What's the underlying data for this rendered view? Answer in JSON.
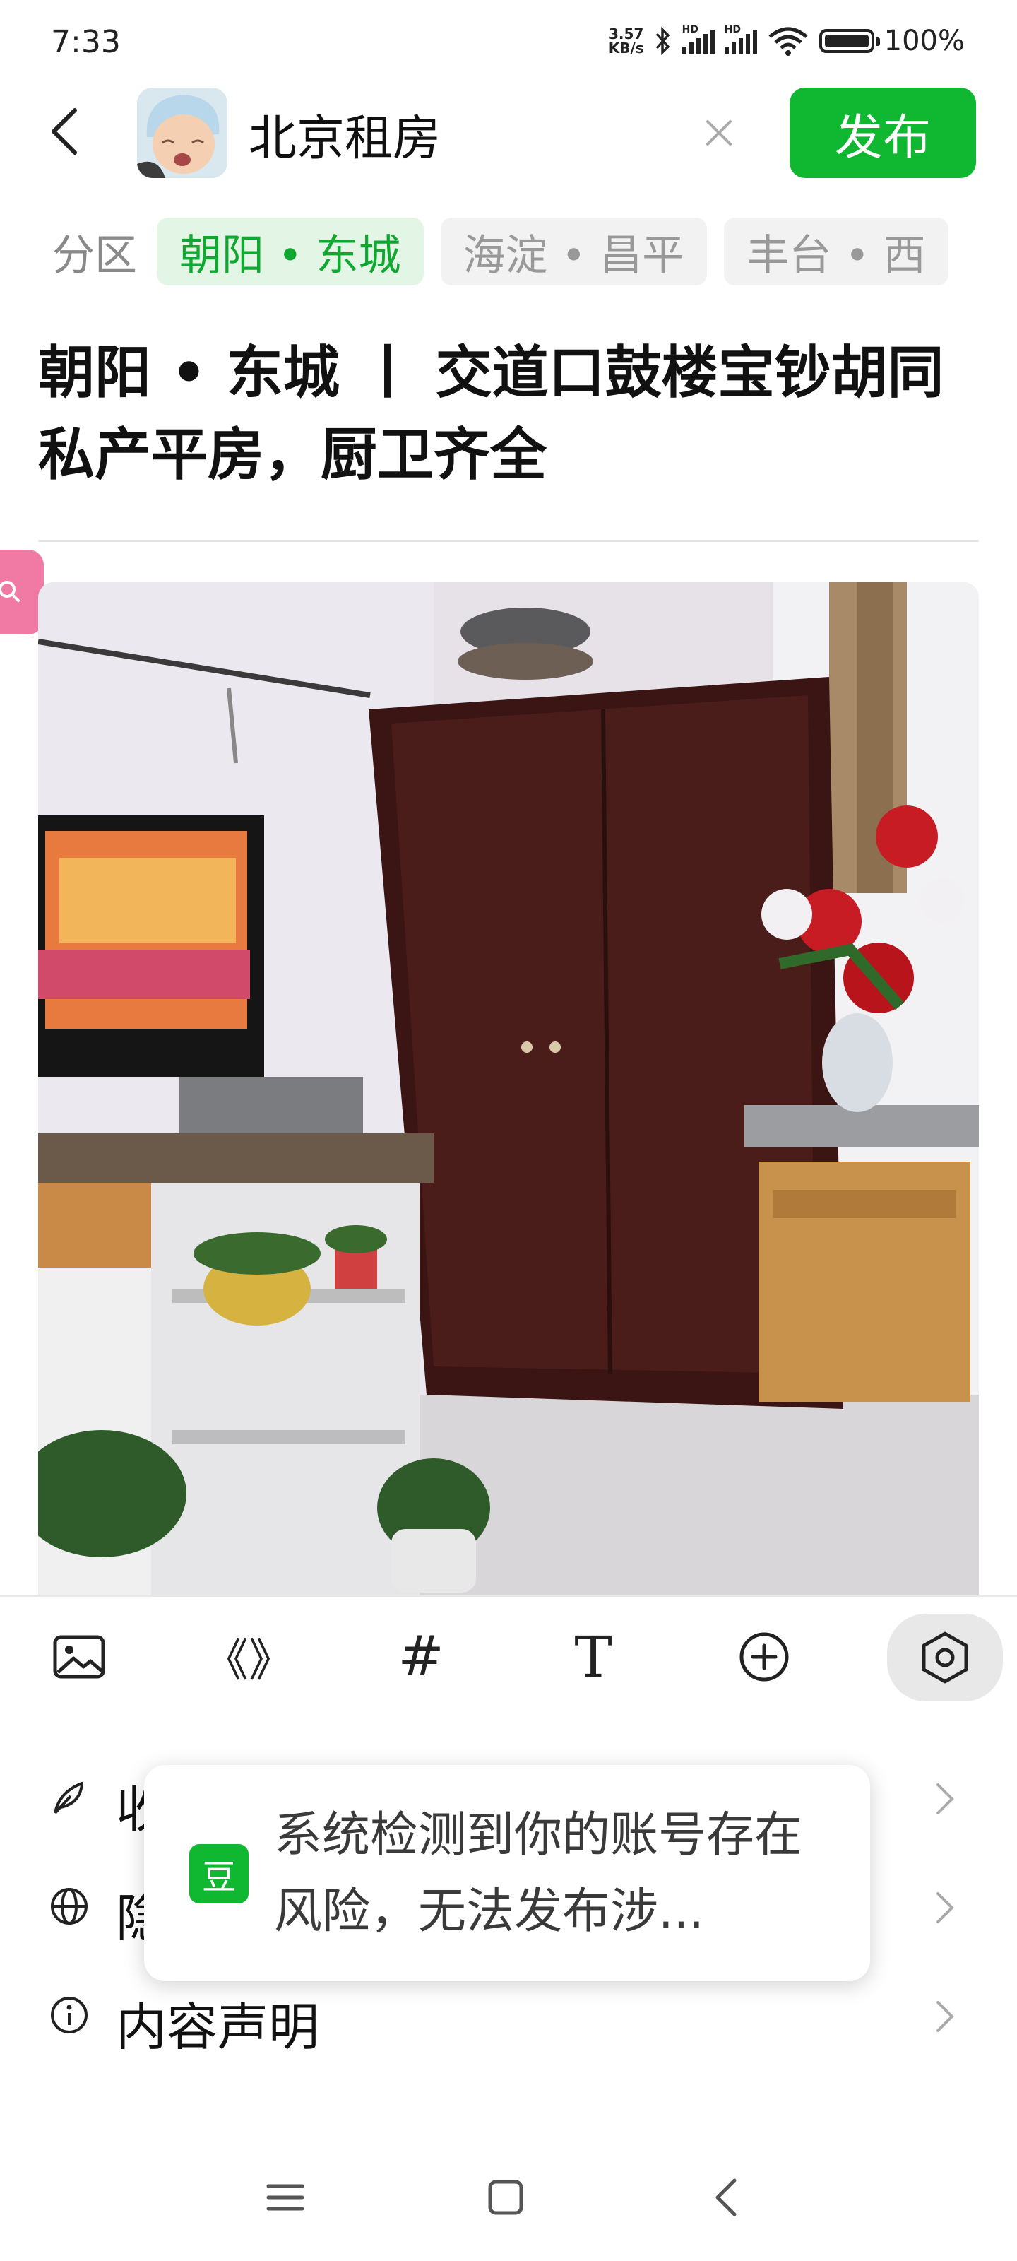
{
  "status_bar": {
    "time": "7:33",
    "net_speed_value": "3.57",
    "net_speed_unit": "KB/s",
    "signal_label": "HD",
    "battery": "100%"
  },
  "header": {
    "title": "北京租房",
    "publish_label": "发布",
    "avatar_icon": "baby-avatar",
    "back_icon": "chevron-left-icon",
    "close_icon": "close-icon"
  },
  "tabs": {
    "label": "分区",
    "items": [
      {
        "label": "朝阳 • 东城",
        "active": true
      },
      {
        "label": "海淀 • 昌平",
        "active": false
      },
      {
        "label": "丰台 • 西",
        "active": false
      }
    ]
  },
  "post": {
    "title": "朝阳 • 东城 丨 交道口鼓楼宝钞胡同私产平房，厨卫齐全"
  },
  "toolbar": {
    "items": [
      "image-icon",
      "quote-brackets-icon",
      "hashtag-icon",
      "text-icon",
      "add-circle-icon",
      "settings-hexagon-icon"
    ],
    "quote_glyph": "《》",
    "hashtag_glyph": "#",
    "text_glyph": "T"
  },
  "settings": {
    "rows": [
      {
        "label": "收",
        "icon": "feather-icon"
      },
      {
        "label": "隐",
        "icon": "globe-icon"
      },
      {
        "label": "内容声明",
        "icon": "info-icon"
      }
    ]
  },
  "toast": {
    "badge": "豆",
    "message": "系统检测到你的账号存在风险，无法发布涉..."
  },
  "colors": {
    "brand_green": "#10b832",
    "tab_active_bg": "#e3f6e6",
    "tab_active_text": "#10a830"
  }
}
